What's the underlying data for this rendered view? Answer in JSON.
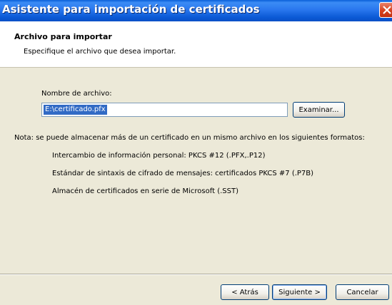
{
  "window": {
    "title": "Asistente para importación de certificados"
  },
  "header": {
    "title": "Archivo para importar",
    "subtitle": "Especifique el archivo que desea importar."
  },
  "file": {
    "label": "Nombre de archivo:",
    "value": "E:\\certificado.pfx",
    "browse_label": "Examinar..."
  },
  "note": {
    "text": "Nota: se puede almacenar más de un certificado en un mismo archivo en los siguientes formatos:",
    "formats": [
      "Intercambio de información personal: PKCS #12 (.PFX,.P12)",
      "Estándar de sintaxis de cifrado de mensajes: certificados PKCS #7 (.P7B)",
      "Almacén de certificados en serie de Microsoft (.SST)"
    ]
  },
  "footer": {
    "back_label": "< Atrás",
    "next_label": "Siguiente >",
    "cancel_label": "Cancelar"
  },
  "icons": {
    "close": "close-icon"
  }
}
